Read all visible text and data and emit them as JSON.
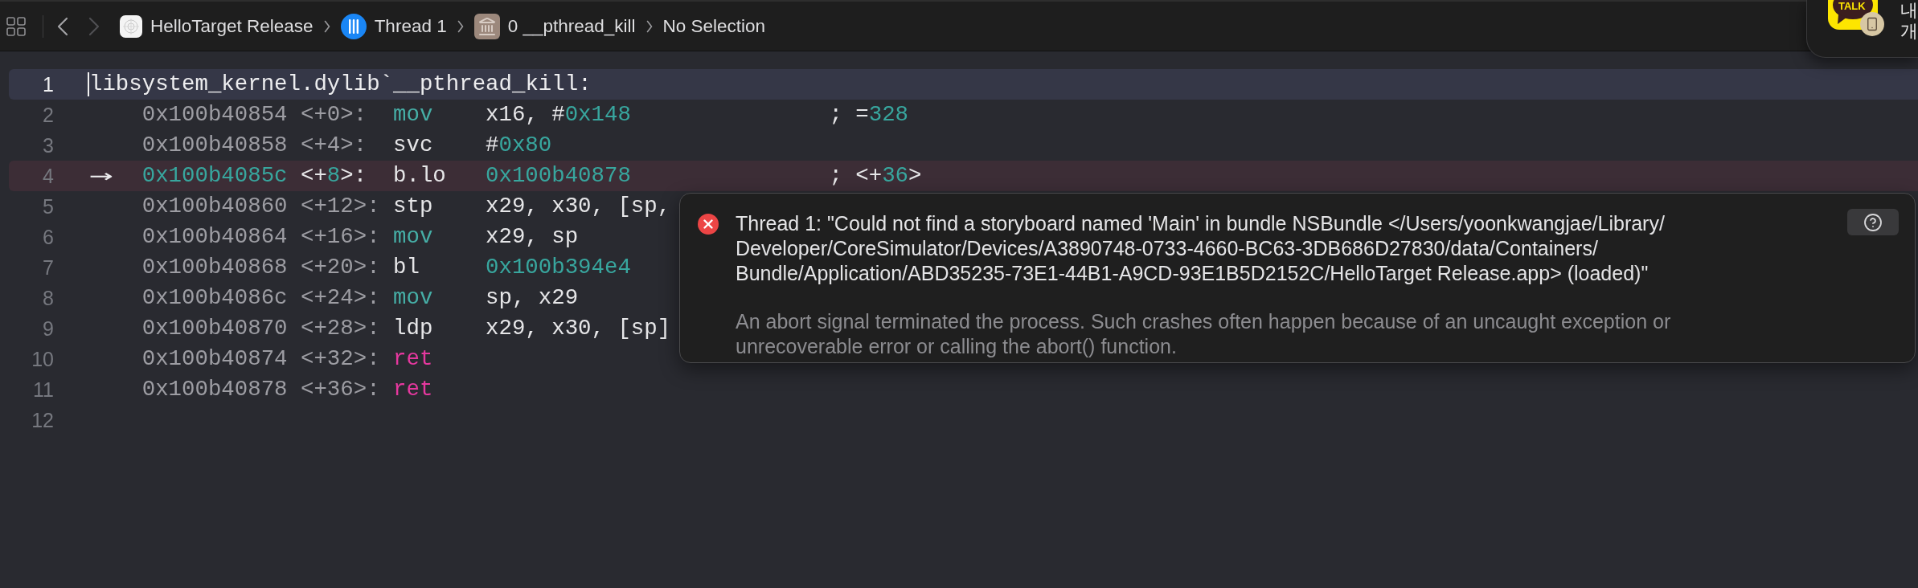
{
  "toolbar": {
    "navigation": [
      {
        "kind": "back",
        "disabled": false
      },
      {
        "kind": "forward",
        "disabled": true
      }
    ],
    "breadcrumbs": [
      {
        "kind": "app",
        "label": "HelloTarget Release"
      },
      {
        "kind": "thread",
        "label": "Thread 1"
      },
      {
        "kind": "frame",
        "label": "0 __pthread_kill"
      },
      {
        "kind": "plain",
        "label": "No Selection"
      }
    ]
  },
  "notification": {
    "logo_text": "TALK",
    "lines": [
      "내",
      "개"
    ]
  },
  "editor": {
    "lines": [
      {
        "number": "1",
        "kind": "label",
        "cursor": true,
        "current": false,
        "text": "libsystem_kernel.dylib`__pthread_kill:"
      },
      {
        "number": "2",
        "kind": "instruction",
        "cursor": false,
        "current": false,
        "address": "0x100b40854",
        "offset": "<+0>:",
        "mnemonic": {
          "text": "mov",
          "kind": "keyword"
        },
        "operands": [
          {
            "text": "x16, #",
            "kind": "plain"
          },
          {
            "text": "0x148",
            "kind": "number"
          }
        ],
        "comment": [
          {
            "text": "; =",
            "kind": "plain"
          },
          {
            "text": "328",
            "kind": "number"
          }
        ]
      },
      {
        "number": "3",
        "kind": "instruction",
        "cursor": false,
        "current": false,
        "address": "0x100b40858",
        "offset": "<+4>:",
        "mnemonic": {
          "text": "svc",
          "kind": "plain"
        },
        "operands": [
          {
            "text": "#",
            "kind": "plain"
          },
          {
            "text": "0x80",
            "kind": "number"
          }
        ]
      },
      {
        "number": "4",
        "kind": "instruction",
        "cursor": false,
        "current": true,
        "marker": "→",
        "address": "0x100b4085c",
        "offset": [
          {
            "text": "<+",
            "kind": "plain"
          },
          {
            "text": "8",
            "kind": "number"
          },
          {
            "text": ">:",
            "kind": "plain"
          }
        ],
        "mnemonic": {
          "text": "b.lo",
          "kind": "plain"
        },
        "operands": [
          {
            "text": "0x100b40878",
            "kind": "number"
          }
        ],
        "comment": [
          {
            "text": "; <+",
            "kind": "plain"
          },
          {
            "text": "36",
            "kind": "number"
          },
          {
            "text": ">",
            "kind": "plain"
          }
        ]
      },
      {
        "number": "5",
        "kind": "instruction",
        "cursor": false,
        "current": false,
        "address": "0x100b40860",
        "offset": "<+12>:",
        "mnemonic": {
          "text": "stp",
          "kind": "plain"
        },
        "operands": [
          {
            "text": "x29, x30, [sp,",
            "kind": "plain"
          }
        ]
      },
      {
        "number": "6",
        "kind": "instruction",
        "cursor": false,
        "current": false,
        "address": "0x100b40864",
        "offset": "<+16>:",
        "mnemonic": {
          "text": "mov",
          "kind": "keyword"
        },
        "operands": [
          {
            "text": "x29, sp",
            "kind": "plain"
          }
        ]
      },
      {
        "number": "7",
        "kind": "instruction",
        "cursor": false,
        "current": false,
        "address": "0x100b40868",
        "offset": "<+20>:",
        "mnemonic": {
          "text": "bl",
          "kind": "plain"
        },
        "operands": [
          {
            "text": "0x100b394e4",
            "kind": "number"
          }
        ]
      },
      {
        "number": "8",
        "kind": "instruction",
        "cursor": false,
        "current": false,
        "address": "0x100b4086c",
        "offset": "<+24>:",
        "mnemonic": {
          "text": "mov",
          "kind": "keyword"
        },
        "operands": [
          {
            "text": "sp, x29",
            "kind": "plain"
          }
        ]
      },
      {
        "number": "9",
        "kind": "instruction",
        "cursor": false,
        "current": false,
        "address": "0x100b40870",
        "offset": "<+28>:",
        "mnemonic": {
          "text": "ldp",
          "kind": "plain"
        },
        "operands": [
          {
            "text": "x29, x30, [sp]",
            "kind": "plain"
          }
        ]
      },
      {
        "number": "10",
        "kind": "instruction",
        "cursor": false,
        "current": false,
        "address": "0x100b40874",
        "offset": "<+32>:",
        "mnemonic": {
          "text": "ret",
          "kind": "return"
        }
      },
      {
        "number": "11",
        "kind": "instruction",
        "cursor": false,
        "current": false,
        "address": "0x100b40878",
        "offset": "<+36>:",
        "mnemonic": {
          "text": "ret",
          "kind": "return"
        }
      },
      {
        "number": "12",
        "kind": "blank",
        "cursor": false,
        "current": false
      }
    ]
  },
  "issue_popover": {
    "kind": "error",
    "message_lines": [
      "Thread 1: \"Could not find a storyboard named 'Main' in bundle NSBundle </Users/yoonkwangjae/Library/",
      "Developer/CoreSimulator/Devices/A3890748-0733-4660-BC63-3DB686D27830/data/Containers/",
      "Bundle/Application/ABD35235-73E1-44B1-A9CD-93E1B5D2152C/HelloTarget Release.app> (loaded)\""
    ],
    "explanation_lines": [
      "An abort signal terminated the process. Such crashes often happen because of an uncaught exception or",
      "unrecoverable error or calling the abort() function."
    ]
  }
}
